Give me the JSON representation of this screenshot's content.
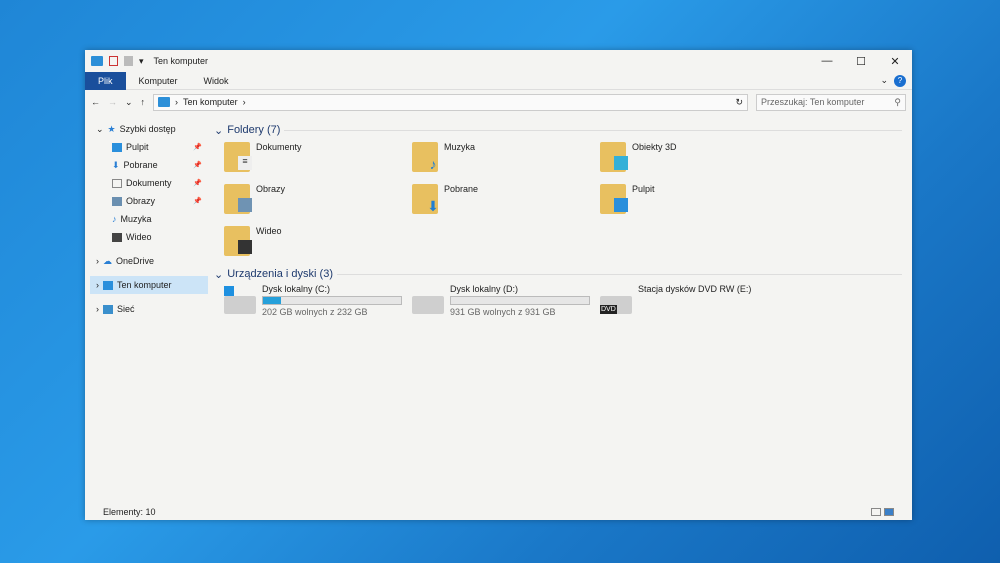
{
  "window": {
    "title": "Ten komputer",
    "minimize": "—",
    "maximize": "☐",
    "close": "✕"
  },
  "ribbon": {
    "tabs": [
      "Plik",
      "Komputer",
      "Widok"
    ],
    "help": "?",
    "collapse": "⌄"
  },
  "address": {
    "back": "←",
    "forward": "→",
    "recent": "⌄",
    "up": "↑",
    "path": "Ten komputer",
    "sep": "›",
    "refresh": "↻",
    "search_placeholder": "Przeszukaj: Ten komputer",
    "search_icon": "⚲"
  },
  "nav": {
    "quick_access": "Szybki dostęp",
    "quick_items": [
      "Pulpit",
      "Pobrane",
      "Dokumenty",
      "Obrazy",
      "Muzyka",
      "Wideo"
    ],
    "onedrive": "OneDrive",
    "this_pc": "Ten komputer",
    "network": "Sieć"
  },
  "folders": {
    "header": "Foldery (7)",
    "items": [
      "Dokumenty",
      "Muzyka",
      "Obiekty 3D",
      "Obrazy",
      "Pobrane",
      "Pulpit",
      "Wideo"
    ]
  },
  "devices": {
    "header": "Urządzenia i dyski (3)",
    "items": [
      {
        "name": "Dysk lokalny (C:)",
        "free": "202 GB wolnych z 232 GB",
        "used_fraction": 0.13
      },
      {
        "name": "Dysk lokalny (D:)",
        "free": "931 GB wolnych z 931 GB",
        "used_fraction": 0.0
      },
      {
        "name": "Stacja dysków DVD RW (E:)",
        "badge": "DVD"
      }
    ]
  },
  "status": {
    "count": "Elementy: 10"
  },
  "colors": {
    "accent": "#1a4f9c",
    "bar": "#26a0da"
  }
}
